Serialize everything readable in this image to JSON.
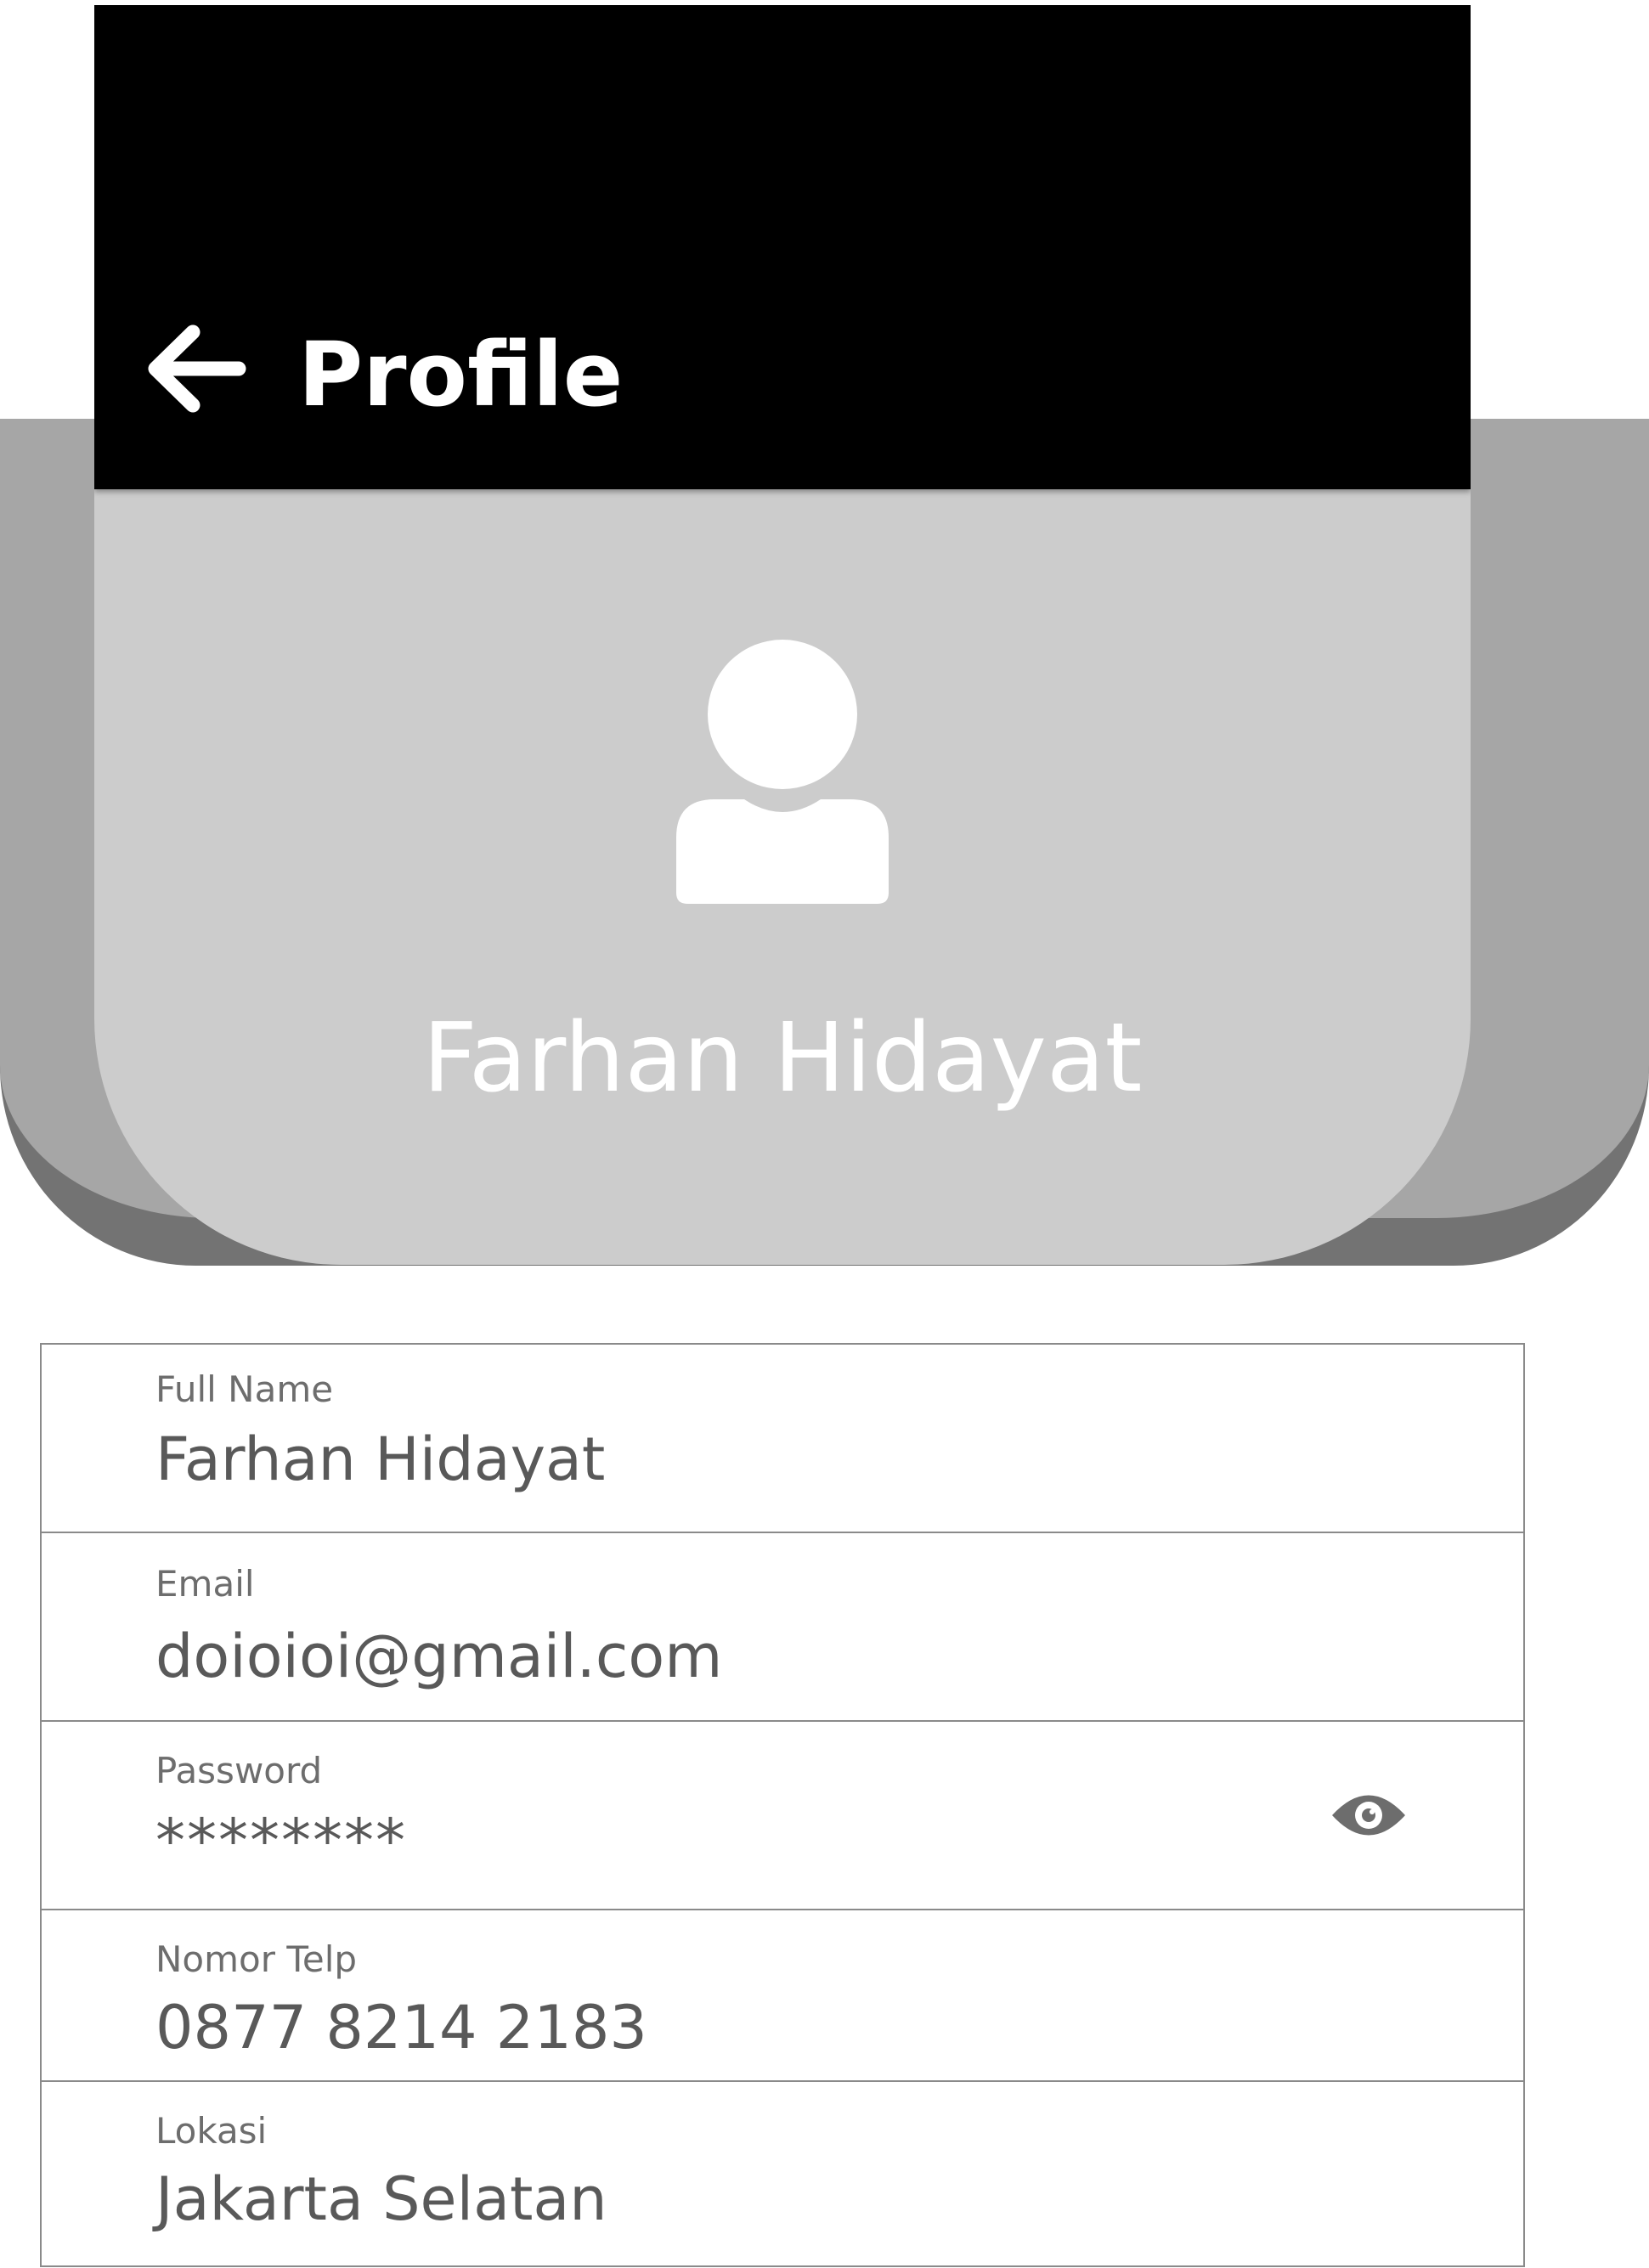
{
  "header": {
    "title": "Profile",
    "back_icon": "arrow-left-icon",
    "background_color": "#000000"
  },
  "profile": {
    "avatar_icon": "person-icon",
    "display_name": "Farhan Hidayat",
    "card_color": "#cccccc"
  },
  "form": {
    "full_name": {
      "label": "Full Name",
      "value": "Farhan Hidayat"
    },
    "email": {
      "label": "Email",
      "value": "doioioi@gmail.com"
    },
    "password": {
      "label": "Password",
      "value": "********",
      "toggle_icon": "eye-icon"
    },
    "phone": {
      "label": "Nomor Telp",
      "value": "0877 8214 2183"
    },
    "location": {
      "label": "Lokasi",
      "value": "Jakarta Selatan"
    }
  }
}
